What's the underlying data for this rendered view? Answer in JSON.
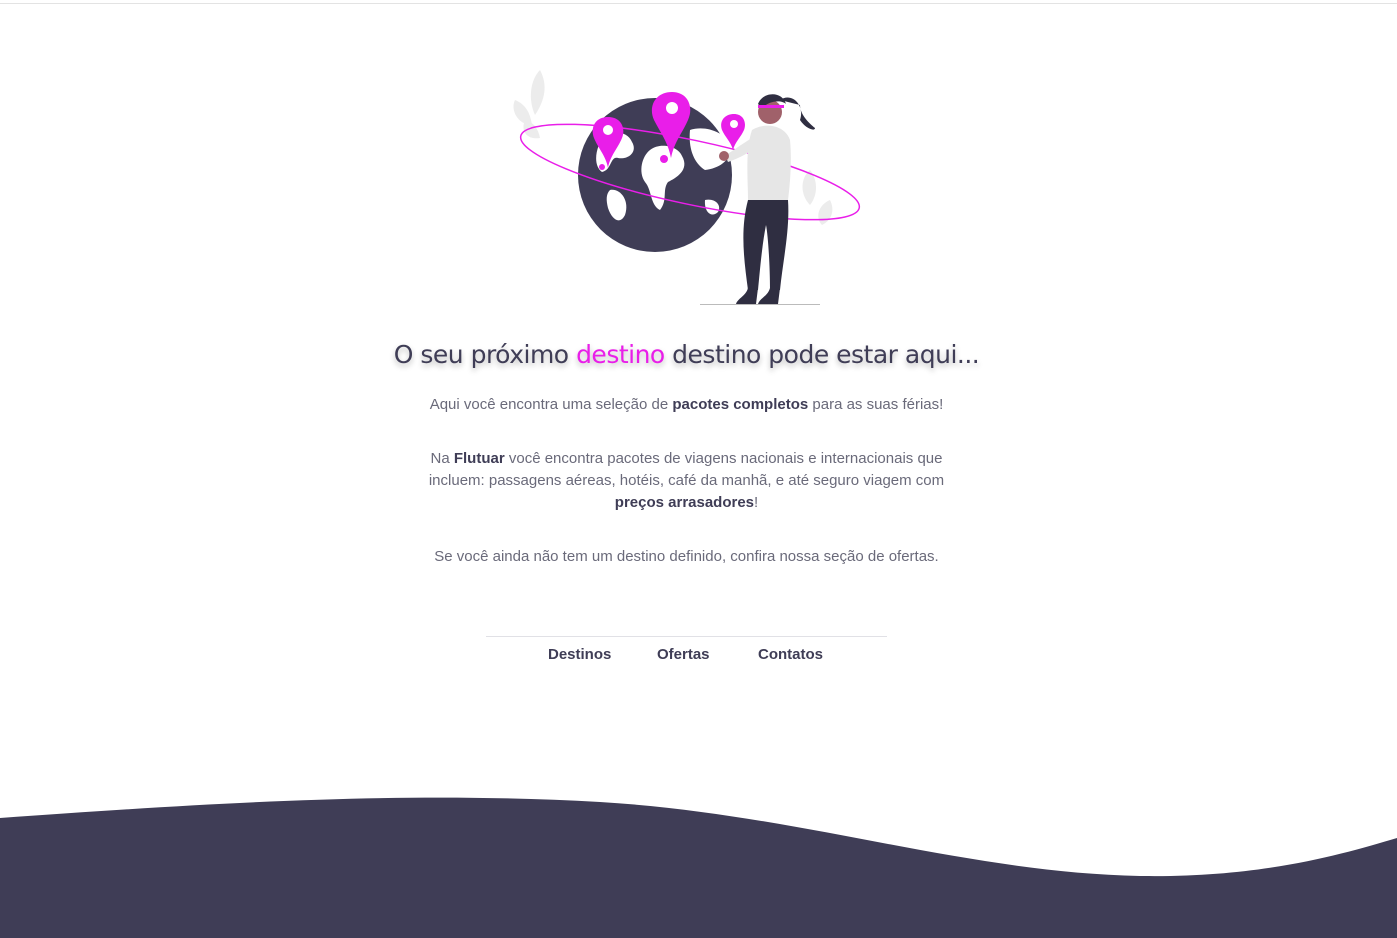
{
  "hero": {
    "title_before": "O seu próximo ",
    "title_accent": "destino",
    "title_after": " destino pode estar aqui..."
  },
  "intro": {
    "p1_before": "Aqui você encontra uma seleção de ",
    "p1_bold": "pacotes completos",
    "p1_after": " para as suas férias!",
    "p2_before": "Na ",
    "p2_brand": "Flutuar",
    "p2_middle": " você encontra pacotes de viagens nacionais e internacionais que incluem: passagens aéreas, hotéis, café da manhã, e até seguro viagem com ",
    "p2_bold": "preços arrasadores",
    "p2_after": "!",
    "p3": "Se você ainda não tem um destino definido, confira nossa seção de ofertas."
  },
  "nav": {
    "destinos": "Destinos",
    "ofertas": "Ofertas",
    "contatos": "Contatos"
  },
  "colors": {
    "accent": "#e91ee9",
    "dark": "#3f3d56",
    "text": "#6a6a7a"
  },
  "icons": [
    "location-pin-icon",
    "globe-icon"
  ]
}
